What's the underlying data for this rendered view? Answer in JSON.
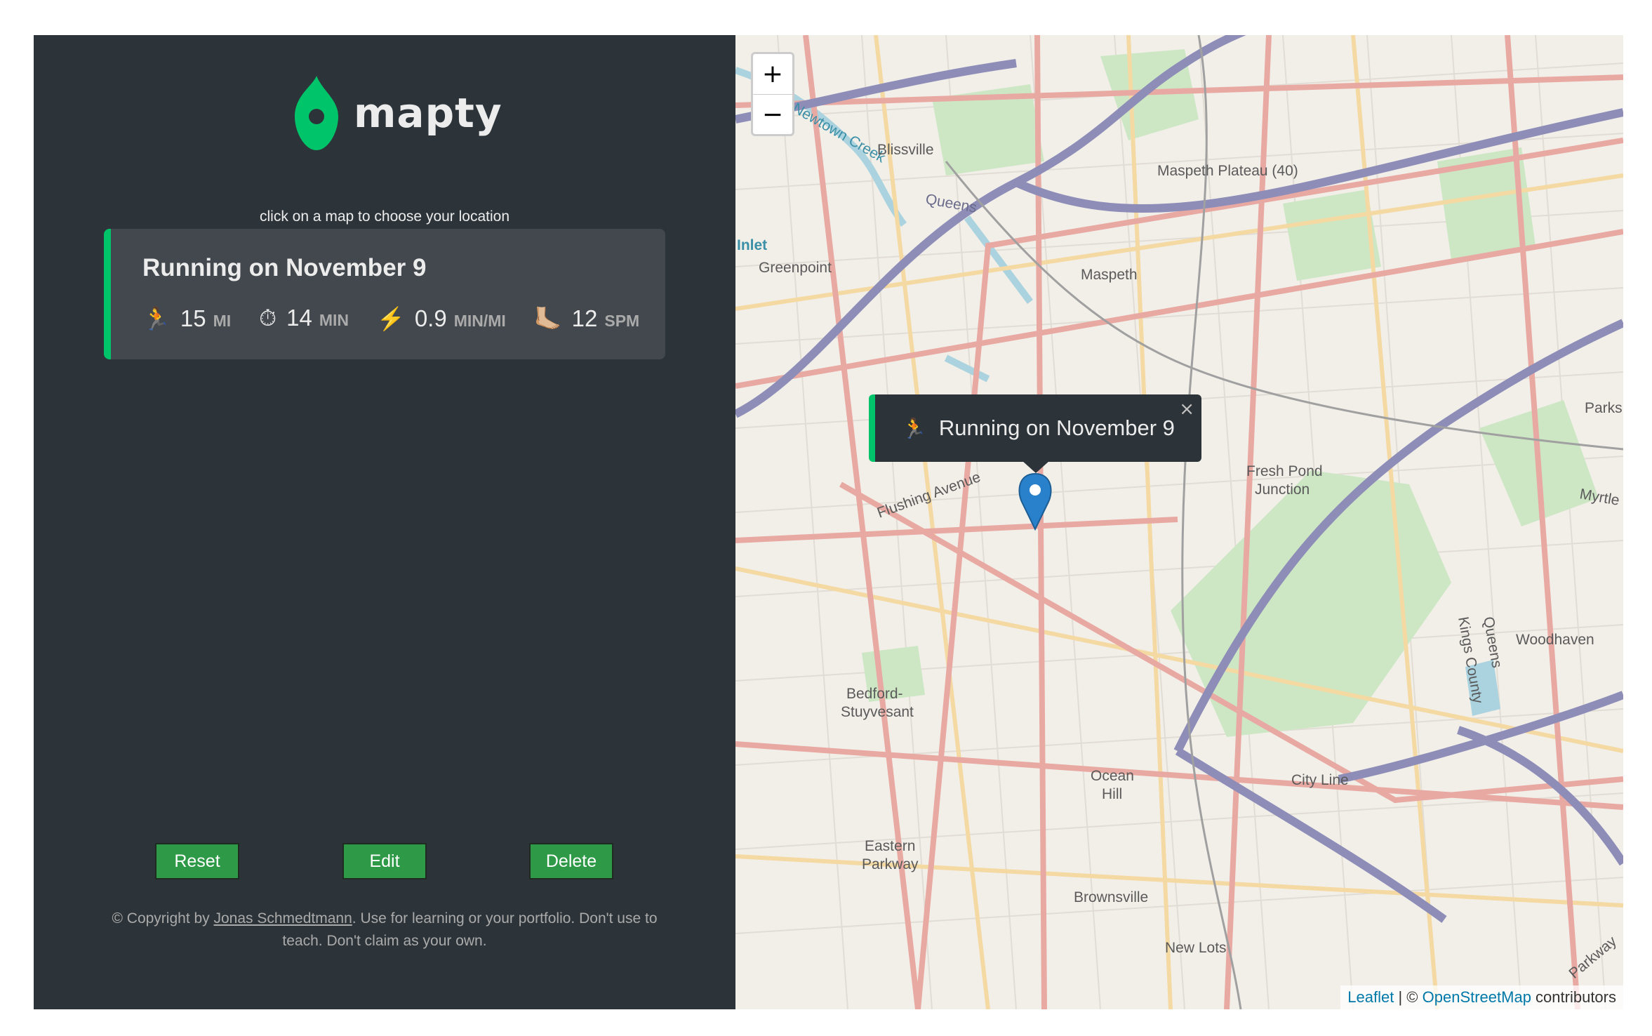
{
  "sidebar": {
    "logo_text": "mapty",
    "hint": "click on a map to choose your location",
    "workout": {
      "title": "Running on November 9",
      "details": [
        {
          "icon": "🏃",
          "icon_name": "runner-icon",
          "value": "15",
          "unit": "MI"
        },
        {
          "icon": "⏱",
          "icon_name": "stopwatch-icon",
          "value": "14",
          "unit": "MIN"
        },
        {
          "icon": "⚡️",
          "icon_name": "lightning-icon",
          "value": "0.9",
          "unit": "MIN/MI"
        },
        {
          "icon": "🦶🏼",
          "icon_name": "foot-icon",
          "value": "12",
          "unit": "SPM"
        }
      ]
    },
    "buttons": {
      "reset": "Reset",
      "edit": "Edit",
      "delete": "Delete"
    },
    "footer": {
      "prefix": "© Copyright by ",
      "author": "Jonas Schmedtmann",
      "suffix": ". Use for learning or your portfolio. Don't use to teach. Don't claim as your own."
    }
  },
  "map": {
    "zoom_in": "+",
    "zoom_out": "−",
    "popup": {
      "icon": "🏃",
      "text": "Running on November 9",
      "close": "×"
    },
    "labels": {
      "newtown_creek": "Newtown Creek",
      "blissville": "Blissville",
      "queens": "Queens",
      "maspeth_plateau": "Maspeth Plateau (40)",
      "inlet": "Inlet",
      "greenpoint": "Greenpoint",
      "maspeth": "Maspeth",
      "parks": "Parks",
      "fresh_pond_1": "Fresh Pond",
      "fresh_pond_2": "Junction",
      "myrtle": "Myrtle",
      "flushing_avenue": "Flushing Avenue",
      "woodhaven": "Woodhaven",
      "kings_county": "Kings County",
      "queens_county": "Queens",
      "bedford_1": "Bedford-",
      "bedford_2": "Stuyvesant",
      "ocean_1": "Ocean",
      "ocean_2": "Hill",
      "city_line": "City Line",
      "eastern_1": "Eastern",
      "eastern_2": "Parkway",
      "brownsville": "Brownsville",
      "new_lots": "New Lots",
      "parkway": "Parkway"
    },
    "attribution": {
      "leaflet": "Leaflet",
      "sep": " | © ",
      "osm": "OpenStreetMap",
      "contributors": " contributors"
    }
  },
  "colors": {
    "accent_green": "#00c46a",
    "sidebar_bg": "#2d3439",
    "card_bg": "#42484d",
    "button_green": "#2e9a47",
    "marker_blue": "#2a81cb"
  }
}
